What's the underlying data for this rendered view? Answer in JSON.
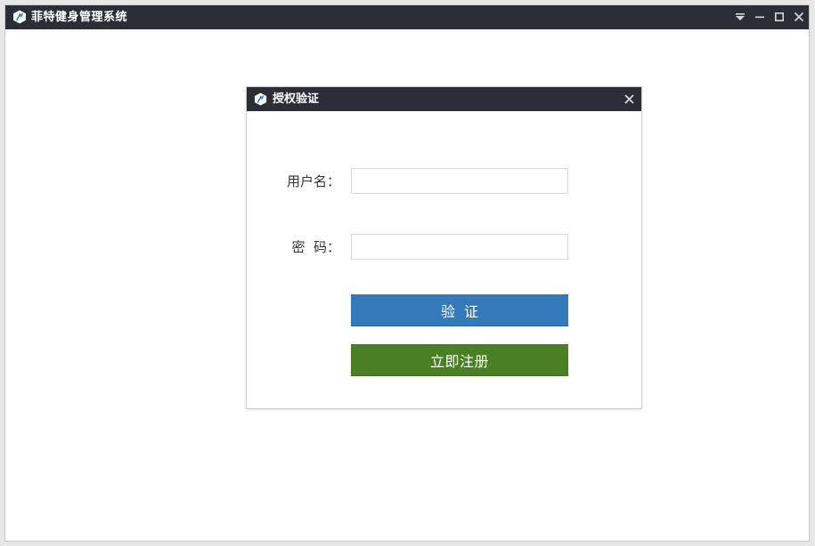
{
  "window": {
    "title": "菲特健身管理系统",
    "icon": "app-logo-icon",
    "controls": [
      "dropdown-icon",
      "minimize-icon",
      "maximize-icon",
      "close-icon"
    ]
  },
  "dialog": {
    "title": "授权验证",
    "icon": "app-logo-icon",
    "close_icon": "close-icon",
    "username": {
      "label": "用户名：",
      "value": "",
      "placeholder": ""
    },
    "password": {
      "label": "密  码：",
      "value": "",
      "placeholder": ""
    },
    "verify_button": "验证",
    "register_button": "立即注册"
  },
  "colors": {
    "titlebar": "#2b2e36",
    "verify": "#3479b9",
    "register": "#4a7f26"
  }
}
